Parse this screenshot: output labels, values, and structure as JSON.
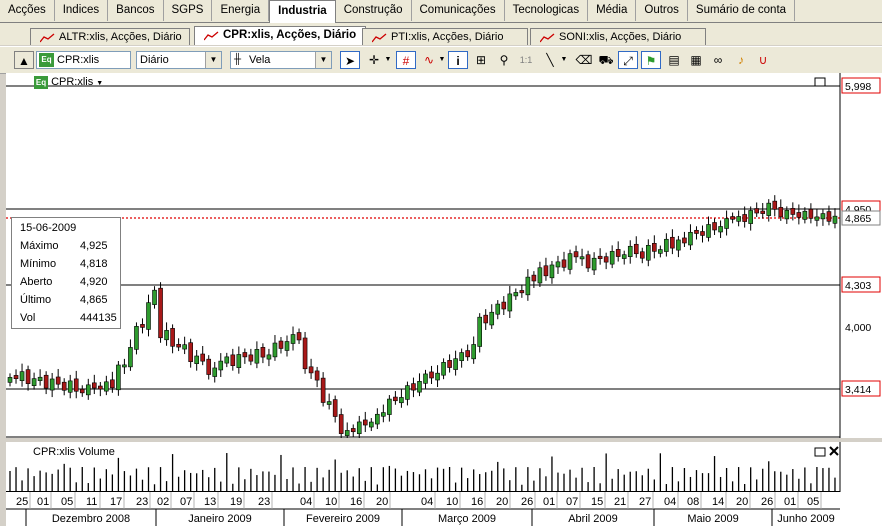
{
  "category_tabs": [
    "Acções",
    "Indices",
    "Bancos",
    "SGPS",
    "Energia",
    "Industria",
    "Construção",
    "Comunicações",
    "Tecnologicas",
    "Média",
    "Outros",
    "Sumário de conta"
  ],
  "active_category": "Industria",
  "doc_tabs": [
    {
      "label": "ALTR:xlis, Acções, Diário",
      "active": false
    },
    {
      "label": "CPR:xlis, Acções, Diário",
      "active": true
    },
    {
      "label": "PTI:xlis, Acções, Diário",
      "active": false
    },
    {
      "label": "SONI:xlis, Acções, Diário",
      "active": false
    }
  ],
  "toolbar": {
    "symbol_badge": "Eq",
    "symbol": "CPR:xlis",
    "period": "Diário",
    "chart_style": "Vela",
    "zoom_label": "1:1"
  },
  "chart": {
    "symbol_label": "CPR:xlis",
    "price_labels": [
      "5,998",
      "4,950",
      "4,865",
      "4,303",
      "4,000",
      "3,414"
    ],
    "current_price": "4,865",
    "volume_label": "CPR:xlis Volume",
    "day_ticks": [
      "25",
      "01",
      "05",
      "11",
      "17",
      "23",
      "02",
      "07",
      "13",
      "19",
      "23",
      "04",
      "10",
      "16",
      "20",
      "04",
      "10",
      "16",
      "20",
      "26",
      "01",
      "07",
      "15",
      "21",
      "27",
      "04",
      "08",
      "14",
      "20",
      "26",
      "01",
      "05"
    ],
    "months": [
      "Dezembro 2008",
      "Janeiro 2009",
      "Fevereiro 2009",
      "Março 2009",
      "Abril 2009",
      "Maio 2009",
      "Junho 2009"
    ]
  },
  "info_box": {
    "date": "15-06-2009",
    "rows": [
      {
        "label": "Máximo",
        "value": "4,925"
      },
      {
        "label": "Mínimo",
        "value": "4,818"
      },
      {
        "label": "Aberto",
        "value": "4,920"
      },
      {
        "label": "Último",
        "value": "4,865"
      },
      {
        "label": "Vol",
        "value": "444135"
      }
    ]
  },
  "colors": {
    "up": "#2e9b2e",
    "down": "#a81818",
    "grid": "#000000",
    "current": "#e00000"
  }
}
